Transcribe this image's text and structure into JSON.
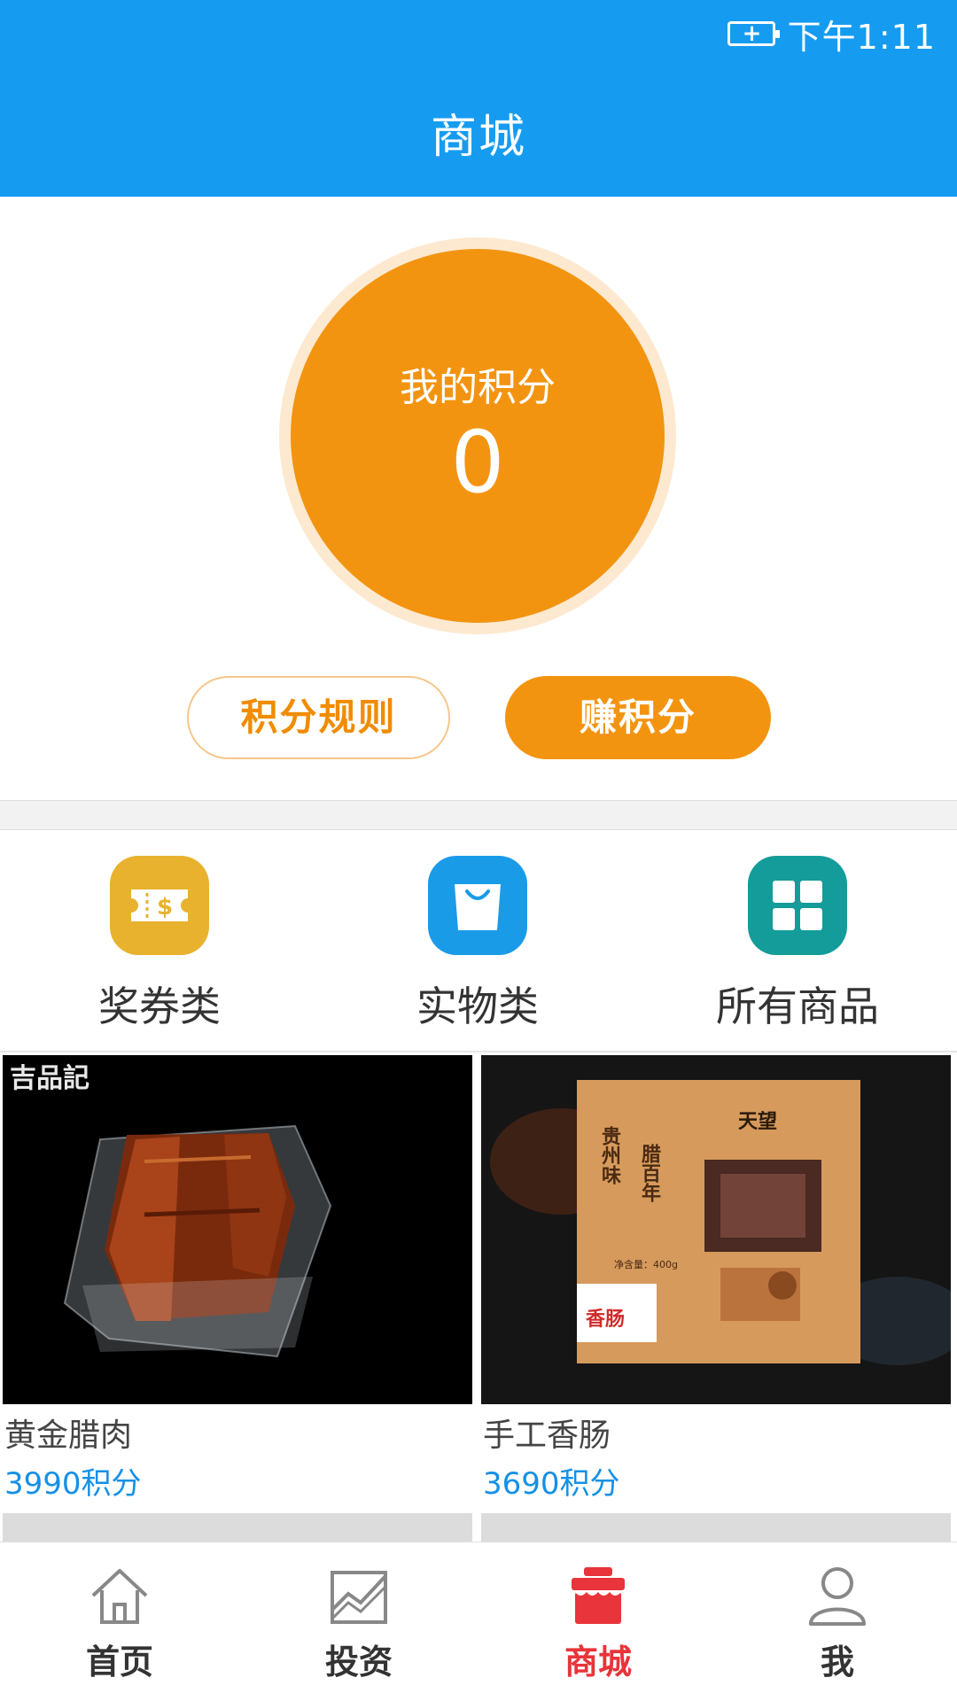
{
  "status_bar": {
    "time": "下午1:11"
  },
  "header": {
    "title": "商城"
  },
  "points": {
    "label": "我的积分",
    "value": "0"
  },
  "actions": {
    "rules_label": "积分规则",
    "earn_label": "赚积分"
  },
  "categories": [
    {
      "label": "奖券类",
      "icon": "coupon-icon",
      "color": "#e8b22e"
    },
    {
      "label": "实物类",
      "icon": "shopping-bag-icon",
      "color": "#1a9be8"
    },
    {
      "label": "所有商品",
      "icon": "grid-icon",
      "color": "#139c9a"
    }
  ],
  "products": [
    {
      "name": "黄金腊肉",
      "price": "3990积分",
      "image_text": "吉品記"
    },
    {
      "name": "手工香肠",
      "price": "3690积分",
      "image_text": [
        "贵州味",
        "腊百年",
        "天望",
        "香肠",
        "净含量：400g"
      ]
    }
  ],
  "bottom_nav": [
    {
      "label": "首页",
      "icon": "home-icon"
    },
    {
      "label": "投资",
      "icon": "chart-icon"
    },
    {
      "label": "商城",
      "icon": "store-icon",
      "active": true
    },
    {
      "label": "我",
      "icon": "user-icon"
    }
  ],
  "colors": {
    "header": "#159cf0",
    "accent_orange": "#f39411",
    "price_blue": "#1590e6",
    "nav_active": "#e8343a"
  }
}
